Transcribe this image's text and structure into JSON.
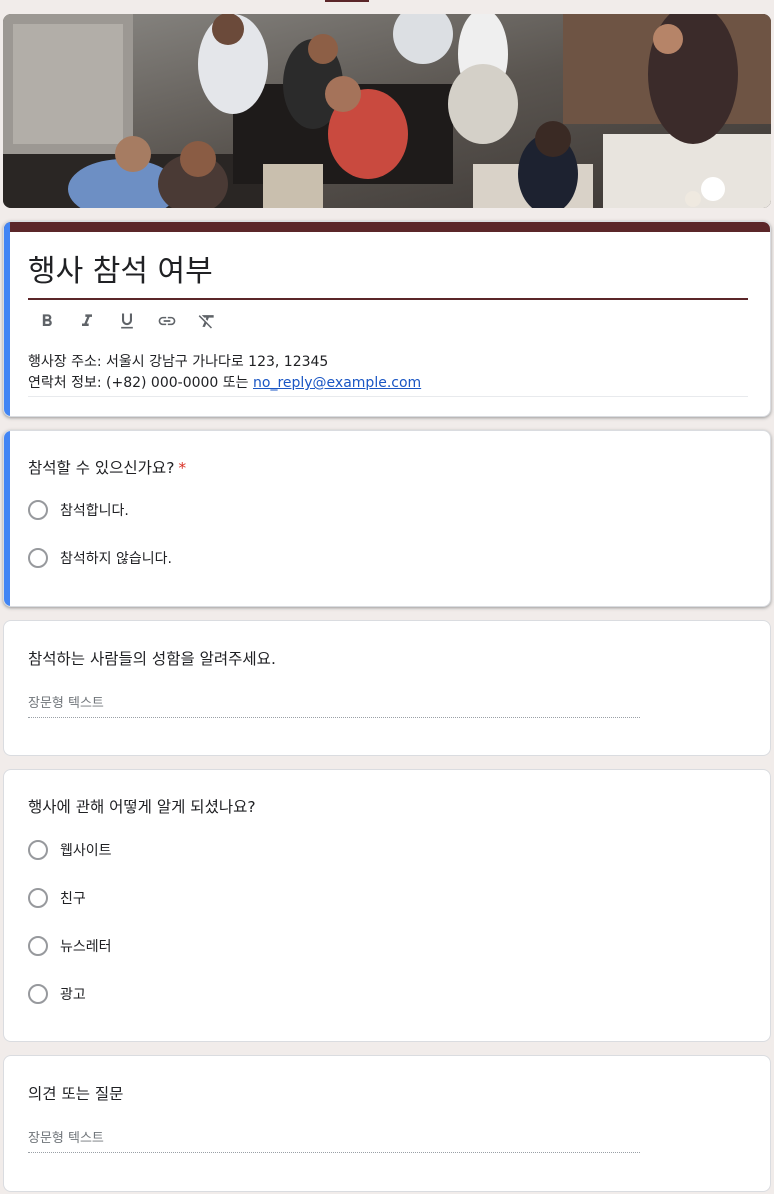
{
  "banner": {
    "image_description": "people at a party"
  },
  "form": {
    "title": "행사 참석 여부",
    "toolbar": {
      "bold_icon": "bold-icon",
      "italic_icon": "italic-icon",
      "underline_icon": "underline-icon",
      "link_icon": "link-icon",
      "clear_format_icon": "clear-format-icon"
    },
    "description_line1": "행사장 주소: 서울시 강남구 가나다로 123, 12345",
    "description_line2_prefix": "연락처 정보: (+82) 000-0000 또는 ",
    "description_email": "no_reply@example.com"
  },
  "questions": [
    {
      "title": "참석할 수 있으신가요?",
      "required_mark": "*",
      "options": [
        "참석합니다.",
        "참석하지 않습니다."
      ]
    },
    {
      "title": "참석하는 사람들의 성함을 알려주세요.",
      "placeholder": "장문형 텍스트"
    },
    {
      "title": "행사에 관해 어떻게 알게 되셨나요?",
      "options": [
        "웹사이트",
        "친구",
        "뉴스레터",
        "광고"
      ]
    },
    {
      "title": "의견 또는 질문",
      "placeholder": "장문형 텍스트"
    }
  ],
  "colors": {
    "theme": "#5b2629",
    "active": "#4285f4",
    "background": "#f1ecea",
    "required": "#d93025",
    "link": "#1a56c4"
  }
}
